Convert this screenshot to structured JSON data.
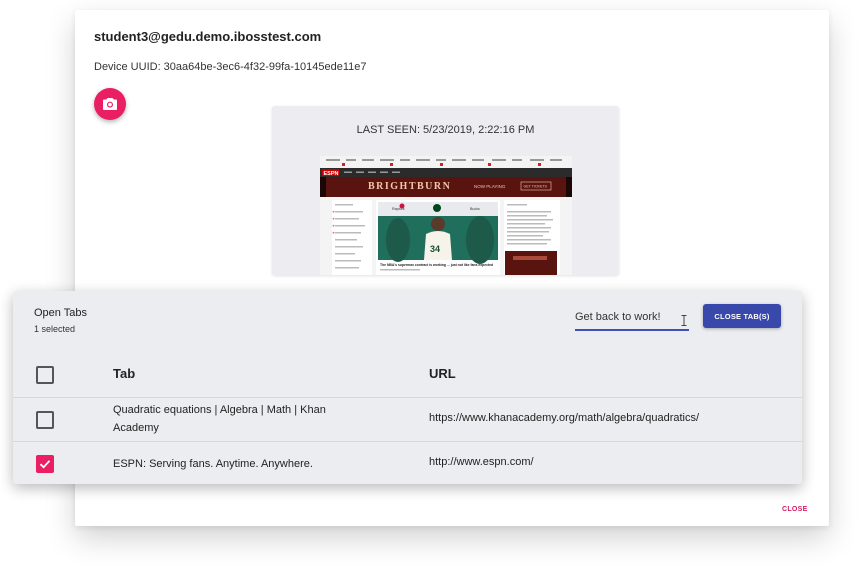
{
  "device": {
    "email": "student3@gedu.demo.ibosstest.com",
    "uuid_label": "Device UUID: 30aa64be-3ec6-4f32-99fa-10145ede11e7",
    "camera_icon": "camera-icon",
    "last_seen": "LAST SEEN: 5/23/2019, 2:22:16 PM"
  },
  "dialog": {
    "close_label": "CLOSE"
  },
  "tabs_panel": {
    "title": "Open Tabs",
    "selected_count": "1 selected",
    "message_value": "Get back to work!",
    "close_tabs_label": "CLOSE TAB(S)",
    "columns": {
      "tab": "Tab",
      "url": "URL"
    },
    "rows": [
      {
        "tab": "Quadratic equations | Algebra | Math | Khan Academy",
        "url": "https://www.khanacademy.org/math/algebra/quadratics/",
        "checked": false
      },
      {
        "tab": "ESPN: Serving fans. Anytime. Anywhere.",
        "url": "http://www.espn.com/",
        "checked": true
      }
    ]
  },
  "thumbnail": {
    "ad_headline": "BRIGHTBURN",
    "ad_tagline": "NOW PLAYING",
    "ad_button": "GET TICKETS",
    "logo": "ESPN",
    "left_team": "Raptors",
    "right_team": "Bucks",
    "jersey_number": "34",
    "article_headline": "The NBA's supermax contract is working ... just not like fans expected"
  },
  "colors": {
    "accent_pink": "#e91e63",
    "primary_blue": "#3949ab",
    "espn_red": "#cc0000"
  }
}
